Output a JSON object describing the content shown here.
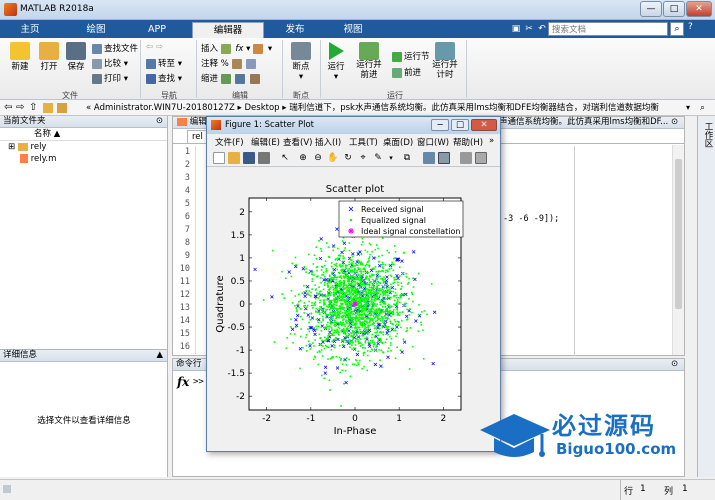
{
  "window": {
    "title": "MATLAB R2018a",
    "minimize": "—",
    "maximize": "□",
    "close": "✕"
  },
  "tabs": [
    {
      "label": "主页"
    },
    {
      "label": "绘图"
    },
    {
      "label": "APP"
    },
    {
      "label": "编辑器"
    },
    {
      "label": "发布"
    },
    {
      "label": "视图"
    }
  ],
  "search": {
    "placeholder": "搜索文档"
  },
  "ribbon": {
    "new": "新建",
    "open": "打开",
    "save": "保存",
    "find_files": "查找文件",
    "compare": "比较",
    "print": "打印",
    "goto": "转至",
    "find": "查找",
    "insert": "插入",
    "comment": "注释",
    "indent": "缩进",
    "breakpoints": "断点",
    "run": "运行",
    "run_advance": "运行并前进",
    "run_section": "运行节",
    "advance": "前进",
    "run_time": "运行并计时",
    "groups": {
      "file": "文件",
      "navigate": "导航",
      "edit": "编辑",
      "breakpoints": "断点",
      "run": "运行"
    }
  },
  "address": {
    "path": "« Administrator.WIN7U-20180127Z ▸ Desktop ▸ 瑞利信道下，psk水声通信系统均衡。此仿真采用lms均衡和DFE均衡器结合，对瑞利信道数据均衡"
  },
  "current_folder": {
    "title": "当前文件夹",
    "column": "名称 ▲",
    "items": [
      {
        "name": "rely"
      },
      {
        "name": "rely.m"
      }
    ]
  },
  "details": {
    "title": "详细信息",
    "empty": "选择文件以查看详细信息"
  },
  "editor": {
    "title": "编辑",
    "tab": "rel",
    "right_title": "声通信系统均衡。此仿真采用lms均衡和DF...",
    "code_fragment": "-3 -6 -9]);",
    "lines": [
      "1",
      "2",
      "3",
      "4",
      "5",
      "6",
      "7",
      "8",
      "9",
      "10",
      "11",
      "12",
      "13",
      "14",
      "15",
      "16"
    ]
  },
  "command_window": {
    "title": "命令行",
    "prompt": ">>"
  },
  "workspace_strip": {
    "label": "工作区"
  },
  "status": {
    "row_label": "行",
    "row_value": "1",
    "col_label": "列",
    "col_value": "1"
  },
  "figure": {
    "title": "Figure 1: Scatter Plot",
    "menu": [
      "文件(F)",
      "编辑(E)",
      "查看(V)",
      "插入(I)",
      "工具(T)",
      "桌面(D)",
      "窗口(W)",
      "帮助(H)"
    ]
  },
  "chart_data": {
    "type": "scatter",
    "title": "Scatter plot",
    "xlabel": "In-Phase",
    "ylabel": "Quadrature",
    "xlim": [
      -2.4,
      2.4
    ],
    "ylim": [
      -2.3,
      2.3
    ],
    "xticks": [
      -2,
      -1,
      0,
      1,
      2
    ],
    "yticks": [
      -2,
      -1.5,
      -1,
      -0.5,
      0,
      0.5,
      1,
      1.5,
      2
    ],
    "legend_position": "top-right",
    "series": [
      {
        "name": "Received signal",
        "marker": "x",
        "color": "#0000ff",
        "spread": 0.65,
        "count": 260
      },
      {
        "name": "Equalized signal",
        "marker": ".",
        "color": "#00ff00",
        "spread": 0.55,
        "count": 1800
      },
      {
        "name": "Ideal signal constellation",
        "marker": "*",
        "color": "#ff00ff",
        "points": [
          [
            0,
            0
          ]
        ]
      }
    ]
  },
  "watermark": {
    "title": "必过源码",
    "url": "Biguo100.com"
  },
  "colors": {
    "tabbar": "#1e5a9c",
    "received": "#0000ff",
    "equalized": "#00ff00",
    "ideal": "#ff00ff"
  }
}
